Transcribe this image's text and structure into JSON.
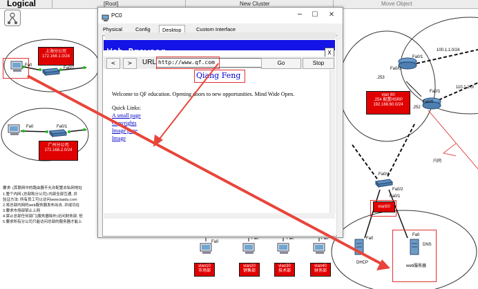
{
  "topbar": {
    "title": "Logical",
    "root": "[Root]",
    "new_cluster": "New Cluster",
    "move_object": "Move Object"
  },
  "network": {
    "shanghai_label": "上海分公司\n172.168.1.0/24",
    "guangzhou_label": "广州分公司\n172.168.2.0/24",
    "vlan60_label": "vlan 60\n.254 配置HSRP\n192.168.60.0/24",
    "vlan50": "vlan50",
    "vlan_boxes": [
      "vlan10\n市场部",
      "vlan20\n销售部",
      "vlan30\n技术部",
      "vlan40\n财务部"
    ],
    "ports": {
      "fa0": "Fa0",
      "fa0_2": "Fa0/2",
      "fa0_1": "Fa0/1",
      "fa0_4": "Fa0/4",
      "fa0_0": "Fa0/0"
    },
    "ips": {
      "net_100": "100.1.1.0/24",
      "net_110": "110.1.1.0/",
      "dot253": ".253",
      "dot252": ".252"
    },
    "intranet": "内网",
    "dhcp": "DHCP",
    "dns": "DNS",
    "web_server": "web服务器",
    "requirements": [
      "要求: (其联网中的路由器不允许配置去私网地址",
      "1.整个内网 (总部和分公司) 内部全部互通, 并",
      "验证方法: 所有员工可以访问www.baidu.com",
      "2.将总部内网的web服务器发布出去, 并成功在",
      "3.要求市场部禁止上网",
      "4.禁止总部任何部门(服务器除外)访问财务部, 但",
      "5.要求所有分公司只能访问总部的服务器才能上"
    ]
  },
  "window": {
    "title": "PC0",
    "tabs": [
      "Physical",
      "Config",
      "Desktop",
      "Custom Interface"
    ],
    "active_tab": "Desktop",
    "min": "─",
    "max": "☐",
    "close": "✕"
  },
  "browser": {
    "title": "Web Browser",
    "close": "X",
    "back": "<",
    "forward": ">",
    "url_label": "URL",
    "url_value": "http://www.qf.com",
    "go": "Go",
    "stop": "Stop",
    "heading": "Qiang Feng",
    "welcome": "Welcome to QF education. Opening doors to new opportunities. Mind Wide Open.",
    "quick_links_title": "Quick Links:",
    "links": [
      "A small page",
      "Copyrights",
      "Image page",
      "Image"
    ]
  },
  "colors": {
    "browser_bar": "#1414e6",
    "red_box": "#e10000",
    "arrow": "#e84a3a",
    "link": "#0000cc"
  }
}
